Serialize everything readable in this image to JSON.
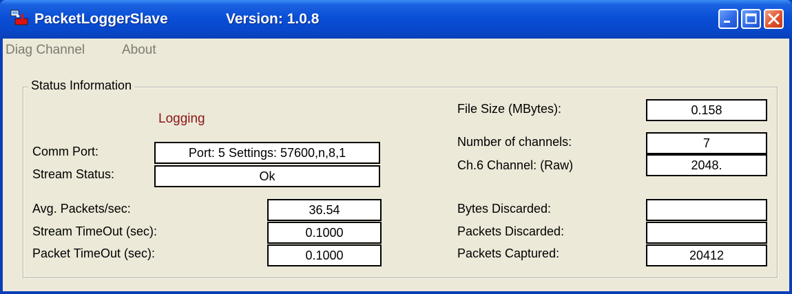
{
  "window": {
    "app_name": "PacketLoggerSlave",
    "version": "Version: 1.0.8"
  },
  "menu": {
    "items": [
      "Diag Channel",
      "About"
    ]
  },
  "group": {
    "title": "Status Information",
    "status_text": "Logging",
    "status_color": "#8a1515"
  },
  "left": {
    "comm_port_label": "Comm Port:",
    "comm_port_value": "Port:  5   Settings: 57600,n,8,1",
    "stream_status_label": "Stream Status:",
    "stream_status_value": "Ok",
    "avg_packets_label": "Avg. Packets/sec:",
    "avg_packets_value": "36.54",
    "stream_timeout_label": "Stream TimeOut (sec):",
    "stream_timeout_value": "0.1000",
    "packet_timeout_label": "Packet TimeOut (sec):",
    "packet_timeout_value": "0.1000"
  },
  "right": {
    "file_size_label": "File Size (MBytes):",
    "file_size_value": "0.158",
    "num_channels_label": "Number of channels:",
    "num_channels_value": "7",
    "channel_label": "Ch.6 Channel: (Raw)",
    "channel_value": "2048.",
    "bytes_discarded_label": "Bytes Discarded:",
    "bytes_discarded_value": "",
    "packets_discarded_label": "Packets Discarded:",
    "packets_discarded_value": "",
    "packets_captured_label": "Packets Captured:",
    "packets_captured_value": "20412"
  },
  "icons": {
    "app": "app-icon",
    "minimize": "minimize-icon",
    "maximize": "maximize-icon",
    "close": "close-icon"
  },
  "colors": {
    "titlebar": "#0a4fd6",
    "dialog_bg": "#ece9d8",
    "close_button": "#e0542e"
  }
}
